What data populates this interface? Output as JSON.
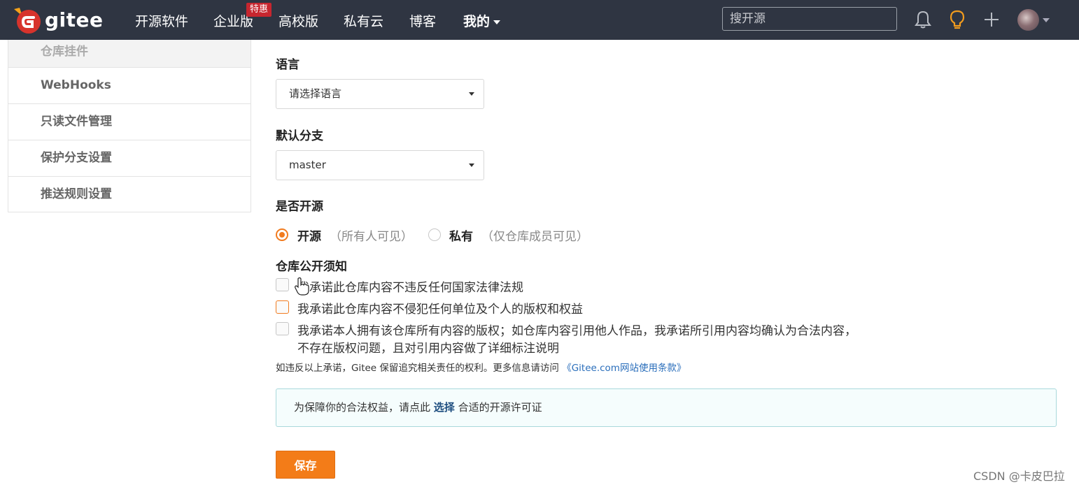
{
  "header": {
    "logo_text": "gitee",
    "nav": [
      {
        "label": "开源软件"
      },
      {
        "label": "企业版",
        "badge": "特惠"
      },
      {
        "label": "高校版"
      },
      {
        "label": "私有云"
      },
      {
        "label": "博客"
      },
      {
        "label": "我的"
      }
    ],
    "search": {
      "placeholder": "搜开源"
    },
    "icons": [
      "bell-icon",
      "lightbulb-icon",
      "plus-icon",
      "avatar"
    ]
  },
  "sidebar": {
    "items": [
      {
        "label": "仓库挂件"
      },
      {
        "label": "WebHooks"
      },
      {
        "label": "只读文件管理"
      },
      {
        "label": "保护分支设置"
      },
      {
        "label": "推送规则设置"
      }
    ]
  },
  "form": {
    "language": {
      "label": "语言",
      "value": "请选择语言"
    },
    "default_branch": {
      "label": "默认分支",
      "value": "master"
    },
    "visibility": {
      "label": "是否开源",
      "options": [
        {
          "title": "开源",
          "desc": "（所有人可见）",
          "selected": true
        },
        {
          "title": "私有",
          "desc": "（仅仓库成员可见）",
          "selected": false
        }
      ]
    },
    "notice": {
      "label": "仓库公开须知",
      "items": [
        {
          "line1": "我承诺此仓库内容不违反任何国家法律法规",
          "checked": false
        },
        {
          "line1": "我承诺此仓库内容不侵犯任何单位及个人的版权和权益",
          "checked": false
        },
        {
          "line1": "我承诺本人拥有该仓库所有内容的版权；如仓库内容引用他人作品，我承诺所引用内容均确认为合法内容，",
          "line2": "不存在版权问题，且对引用内容做了详细标注说明",
          "checked": false
        }
      ]
    },
    "disclaimer": {
      "text": "如违反以上承诺，Gitee 保留追究相关责任的权利。更多信息请访问",
      "link": "《Gitee.com网站使用条款》"
    },
    "license_tip": {
      "before": "为保障你的合法权益，请点此",
      "action": "选择",
      "after": "合适的开源许可证"
    },
    "save_label": "保存"
  },
  "watermark": "CSDN @卡皮巴拉",
  "colors": {
    "nav_bg": "#2f3542",
    "accent": "#f37c18",
    "badge": "#c7262f",
    "info_border": "#a9d9dc"
  }
}
